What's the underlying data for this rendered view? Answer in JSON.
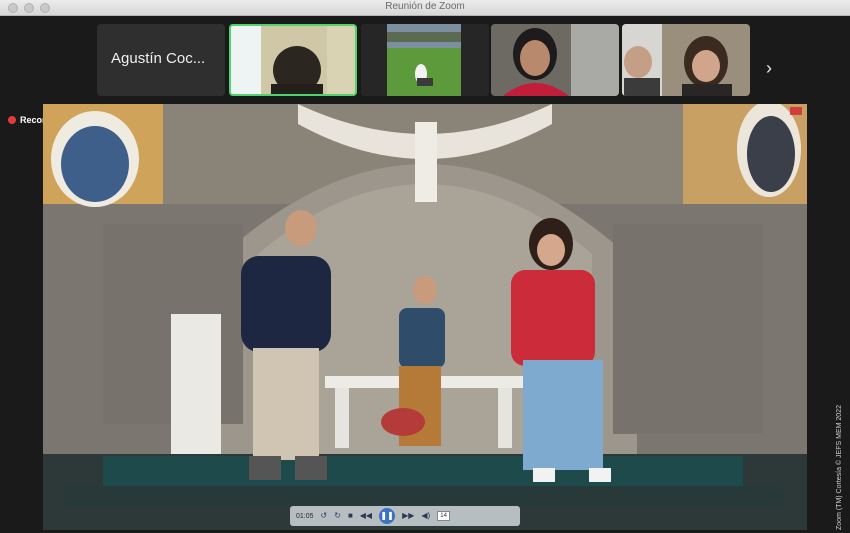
{
  "window": {
    "title": "Reunión de Zoom"
  },
  "gallery": {
    "participants": [
      {
        "name": "Agustín Coc..."
      },
      {
        "name": ""
      },
      {
        "name": ""
      },
      {
        "name": ""
      },
      {
        "name": ""
      }
    ],
    "next_icon": "chevron-right-icon"
  },
  "recording": {
    "label": "Recording"
  },
  "media": {
    "time": "01:05",
    "volume": "14"
  },
  "credit": "Zoom (TM) Cortesía © JEFS MEM 2022",
  "colors": {
    "active_border": "#4fd36a",
    "record": "#e23b3b",
    "background": "#1a1a1a"
  }
}
